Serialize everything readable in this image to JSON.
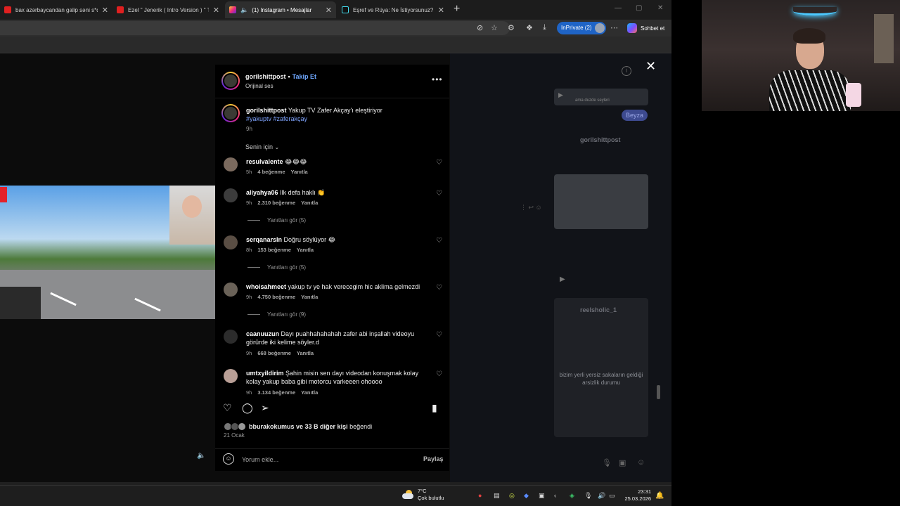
{
  "browser": {
    "tabs": [
      {
        "title": "bax azərbaycandan galip səni s*qim",
        "favicon": "youtube-icon",
        "active": false
      },
      {
        "title": "Ezel \" Jenerik ( Intro Version ) \" Toy",
        "favicon": "youtube-icon",
        "active": false
      },
      {
        "title": "(1) Instagram • Mesajlar",
        "favicon": "instagram-icon",
        "active": true
      },
      {
        "title": "Eşref ve Rüya: Ne İstiyorsunuz? | Ti",
        "favicon": "tiktok-icon",
        "active": false
      }
    ],
    "inprivate_label": "InPrivate (2)",
    "copilot_label": "Sohbet et"
  },
  "post": {
    "username": "gorilshittpost",
    "follow_label": "Takip Et",
    "audio": "Orijinal ses",
    "caption_user": "gorilshittpost",
    "caption_text": "Yakup TV Zafer Akçay'ı eleştiriyor",
    "caption_tags": "#yakuptv #zaferakçay",
    "caption_time": "9h",
    "filter_label": "Senin için",
    "likes_users": "bburakokumus",
    "likes_text": "ve 33 B diğer kişi",
    "likes_suffix": "beğendi",
    "date": "21 Ocak",
    "comment_placeholder": "Yorum ekle...",
    "share_label": "Paylaş"
  },
  "comments": [
    {
      "user": "resulvalente",
      "text": "😂😂😂",
      "time": "5h",
      "likes": "4 beğenme",
      "reply": "Yanıtla",
      "replies": ""
    },
    {
      "user": "aliyahya06",
      "text": "Ilk defa haklı 👏",
      "time": "9h",
      "likes": "2.310 beğenme",
      "reply": "Yanıtla",
      "replies": "Yanıtları gör (5)"
    },
    {
      "user": "serqanarsln",
      "text": "Doğru söylüyor 😂",
      "time": "8h",
      "likes": "153 beğenme",
      "reply": "Yanıtla",
      "replies": "Yanıtları gör (5)"
    },
    {
      "user": "whoisahmeet",
      "text": "yakup tv ye hak verecegim hic aklima gelmezdi",
      "time": "9h",
      "likes": "4.750 beğenme",
      "reply": "Yanıtla",
      "replies": "Yanıtları gör (9)"
    },
    {
      "user": "caanuuzun",
      "text": "Dayı puahhahahahah zafer abi inşallah videoyu görürde iki kelime söyler.d",
      "time": "9h",
      "likes": "668 beğenme",
      "reply": "Yanıtla",
      "replies": ""
    },
    {
      "user": "umtxyildirim",
      "text": "Şahin misin sen dayı videodan konuşmak kolay kolay yakup baba gibi motorcu varkeeen ohoooo",
      "time": "9h",
      "likes": "3.134 beğenme",
      "reply": "Yanıtla",
      "replies": ""
    }
  ],
  "dm_background": {
    "bubble_label": "Beyza",
    "sender1": "gorilshittpost",
    "sender2": "reelsholic_1",
    "caption": "bizim yerli yersiz sakaların geldiği arsizlik durumu",
    "thumb_text": "ama duzde seyleri"
  },
  "taskbar": {
    "temp": "7°C",
    "weather": "Çok bulutlu",
    "time": "23:31",
    "date": "25.03.2026"
  },
  "colors": {
    "accent_link": "#6fa8ff",
    "inprivate": "#1f64c6",
    "hashtag": "#7fa4ff"
  }
}
